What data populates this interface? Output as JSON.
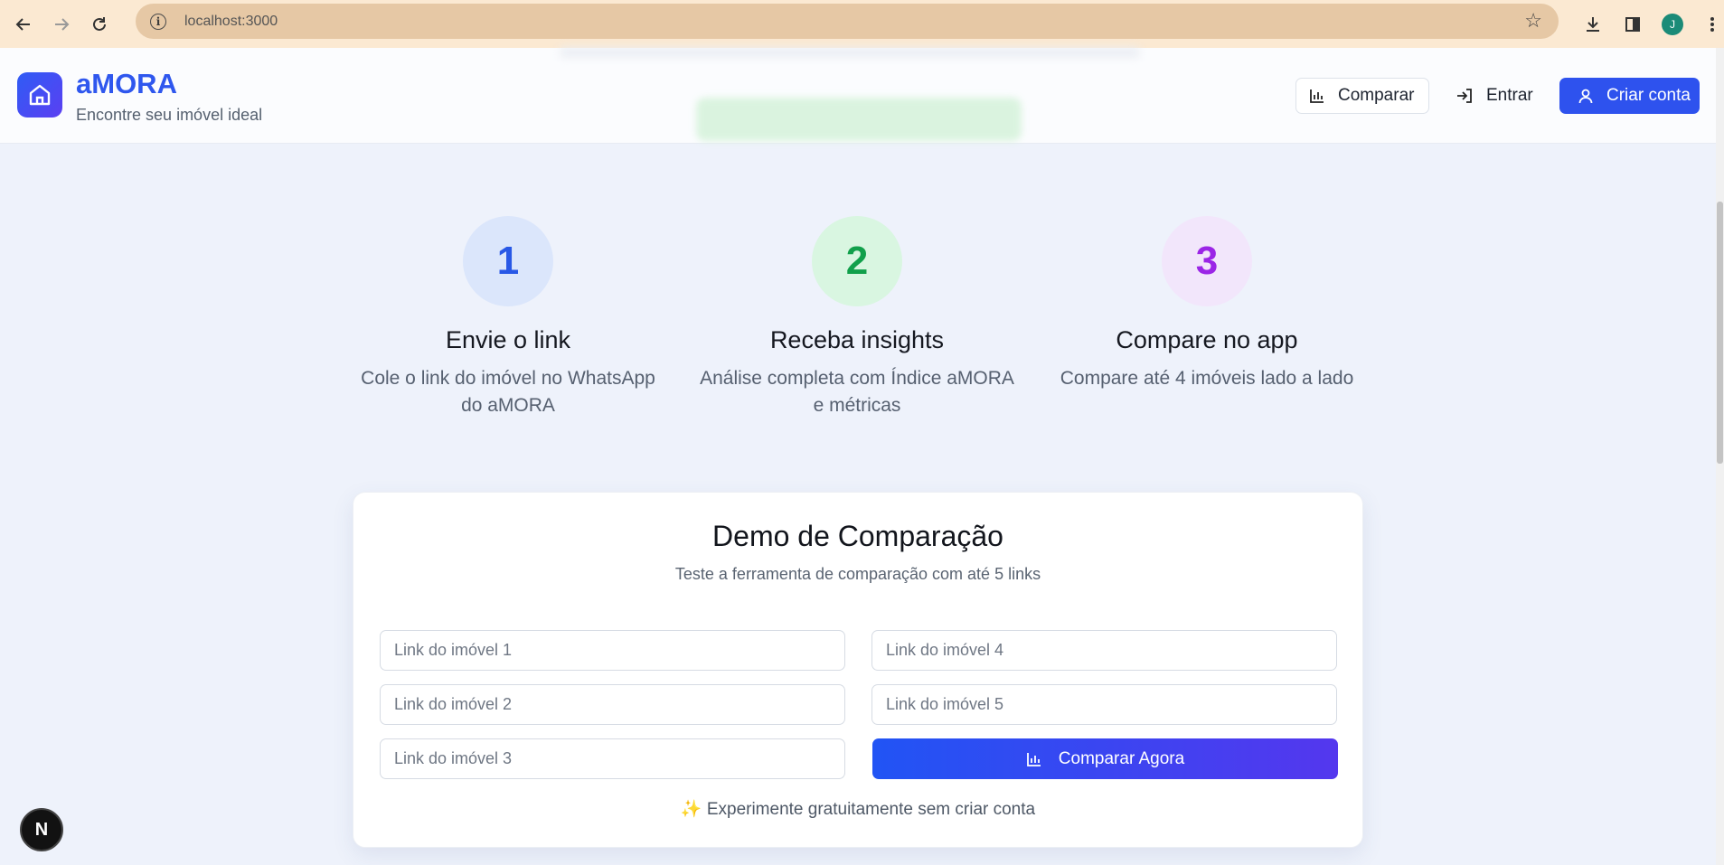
{
  "browser": {
    "url": "localhost:3000",
    "profile_initial": "J",
    "icons": [
      "back-arrow-icon",
      "forward-arrow-icon",
      "reload-icon",
      "site-info-icon",
      "bookmark-star-icon",
      "download-icon",
      "side-panel-icon",
      "profile-avatar",
      "kebab-menu-icon"
    ]
  },
  "header": {
    "brand": "aMORA",
    "tagline": "Encontre seu imóvel ideal",
    "compare_label": "Comparar",
    "login_label": "Entrar",
    "signup_label": "Criar conta"
  },
  "steps": [
    {
      "number": "1",
      "title": "Envie o link",
      "description": "Cole o link do imóvel no WhatsApp do aMORA",
      "color": "#2858e6"
    },
    {
      "number": "2",
      "title": "Receba insights",
      "description": "Análise completa com Índice aMORA e métricas",
      "color": "#11a04b"
    },
    {
      "number": "3",
      "title": "Compare no app",
      "description": "Compare até 4 imóveis lado a lado",
      "color": "#9b25e6"
    }
  ],
  "demo": {
    "title": "Demo de Comparação",
    "subtitle": "Teste a ferramenta de comparação com até 5 links",
    "placeholders": [
      "Link do imóvel 1",
      "Link do imóvel 2",
      "Link do imóvel 3",
      "Link do imóvel 4",
      "Link do imóvel 5"
    ],
    "button_label": "Comparar Agora",
    "note": "✨ Experimente gratuitamente sem criar conta"
  },
  "dev_badge": "N",
  "colors": {
    "primary": "#2e52ee",
    "background": "#eef2fb"
  }
}
